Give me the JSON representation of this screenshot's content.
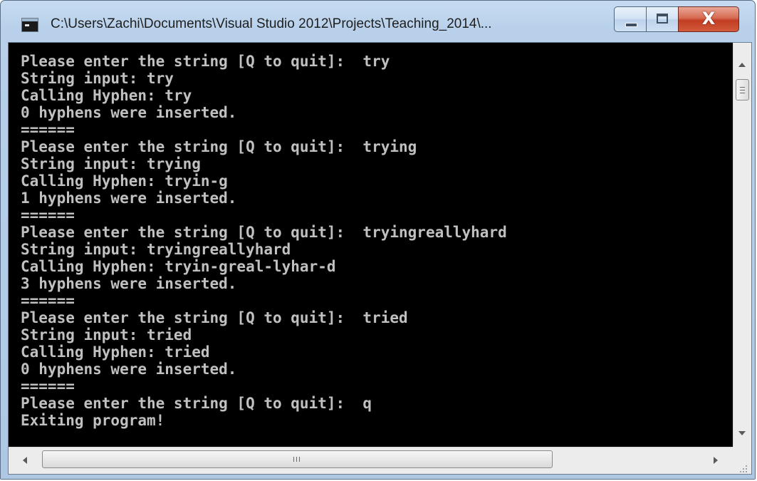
{
  "window": {
    "title": "C:\\Users\\Zachi\\Documents\\Visual Studio 2012\\Projects\\Teaching_2014\\...",
    "close_glyph": "X"
  },
  "console": {
    "lines": [
      "Please enter the string [Q to quit]:  try",
      "String input: try",
      "Calling Hyphen: try",
      "0 hyphens were inserted.",
      "======",
      "Please enter the string [Q to quit]:  trying",
      "String input: trying",
      "Calling Hyphen: tryin-g",
      "1 hyphens were inserted.",
      "======",
      "Please enter the string [Q to quit]:  tryingreallyhard",
      "String input: tryingreallyhard",
      "Calling Hyphen: tryin-greal-lyhar-d",
      "3 hyphens were inserted.",
      "======",
      "Please enter the string [Q to quit]:  tried",
      "String input: tried",
      "Calling Hyphen: tried",
      "0 hyphens were inserted.",
      "======",
      "Please enter the string [Q to quit]:  q",
      "Exiting program!"
    ]
  },
  "colors": {
    "console_background": "#000000",
    "console_text": "#c0c0c0",
    "close_button": "#c94a2f"
  },
  "icons": {
    "app": "console-app-icon",
    "minimize": "minimize-icon",
    "maximize": "maximize-icon",
    "close": "close-icon"
  }
}
